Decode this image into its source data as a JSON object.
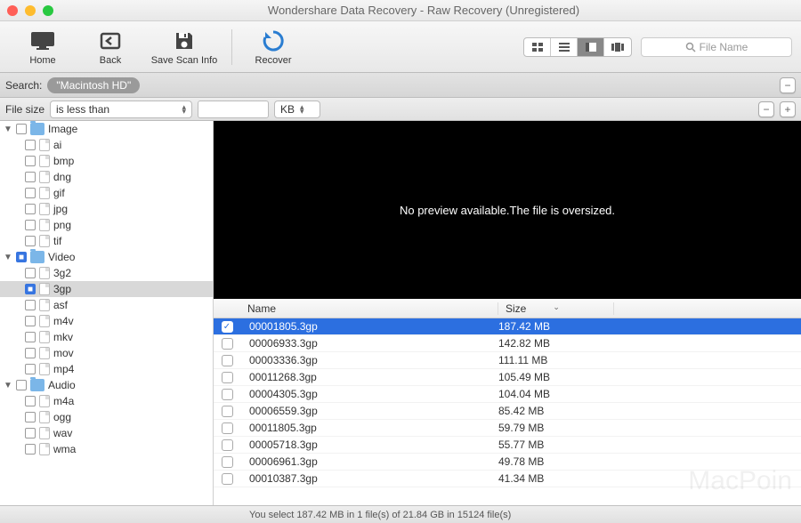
{
  "window": {
    "title": "Wondershare Data Recovery - Raw Recovery (Unregistered)"
  },
  "toolbar": {
    "home": "Home",
    "back": "Back",
    "save_scan": "Save Scan Info",
    "recover": "Recover",
    "search_placeholder": "File Name"
  },
  "search": {
    "label": "Search:",
    "token": "\"Macintosh HD\""
  },
  "filter": {
    "field": "File size",
    "op": "is less than",
    "unit": "KB"
  },
  "sidebar": {
    "groups": [
      {
        "label": "Image",
        "expanded": true,
        "checked": false,
        "items": [
          {
            "label": "ai"
          },
          {
            "label": "bmp"
          },
          {
            "label": "dng"
          },
          {
            "label": "gif"
          },
          {
            "label": "jpg"
          },
          {
            "label": "png"
          },
          {
            "label": "tif"
          }
        ]
      },
      {
        "label": "Video",
        "expanded": true,
        "checked": true,
        "items": [
          {
            "label": "3g2"
          },
          {
            "label": "3gp",
            "selected": true,
            "checked": true
          },
          {
            "label": "asf"
          },
          {
            "label": "m4v"
          },
          {
            "label": "mkv"
          },
          {
            "label": "mov"
          },
          {
            "label": "mp4"
          }
        ]
      },
      {
        "label": "Audio",
        "expanded": true,
        "checked": false,
        "items": [
          {
            "label": "m4a"
          },
          {
            "label": "ogg"
          },
          {
            "label": "wav"
          },
          {
            "label": "wma"
          }
        ]
      }
    ]
  },
  "preview": {
    "message": "No preview available.The file is oversized."
  },
  "table": {
    "headers": {
      "name": "Name",
      "size": "Size"
    },
    "rows": [
      {
        "name": "00001805.3gp",
        "size": "187.42 MB",
        "selected": true,
        "checked": true
      },
      {
        "name": "00006933.3gp",
        "size": "142.82 MB"
      },
      {
        "name": "00003336.3gp",
        "size": "111.11 MB"
      },
      {
        "name": "00011268.3gp",
        "size": "105.49 MB"
      },
      {
        "name": "00004305.3gp",
        "size": "104.04 MB"
      },
      {
        "name": "00006559.3gp",
        "size": "85.42 MB"
      },
      {
        "name": "00011805.3gp",
        "size": "59.79 MB"
      },
      {
        "name": "00005718.3gp",
        "size": "55.77 MB"
      },
      {
        "name": "00006961.3gp",
        "size": "49.78 MB"
      },
      {
        "name": "00010387.3gp",
        "size": "41.34 MB"
      }
    ]
  },
  "status": {
    "text": "You select 187.42 MB in 1 file(s) of 21.84 GB in 15124 file(s)"
  },
  "watermark": "MacPoin"
}
